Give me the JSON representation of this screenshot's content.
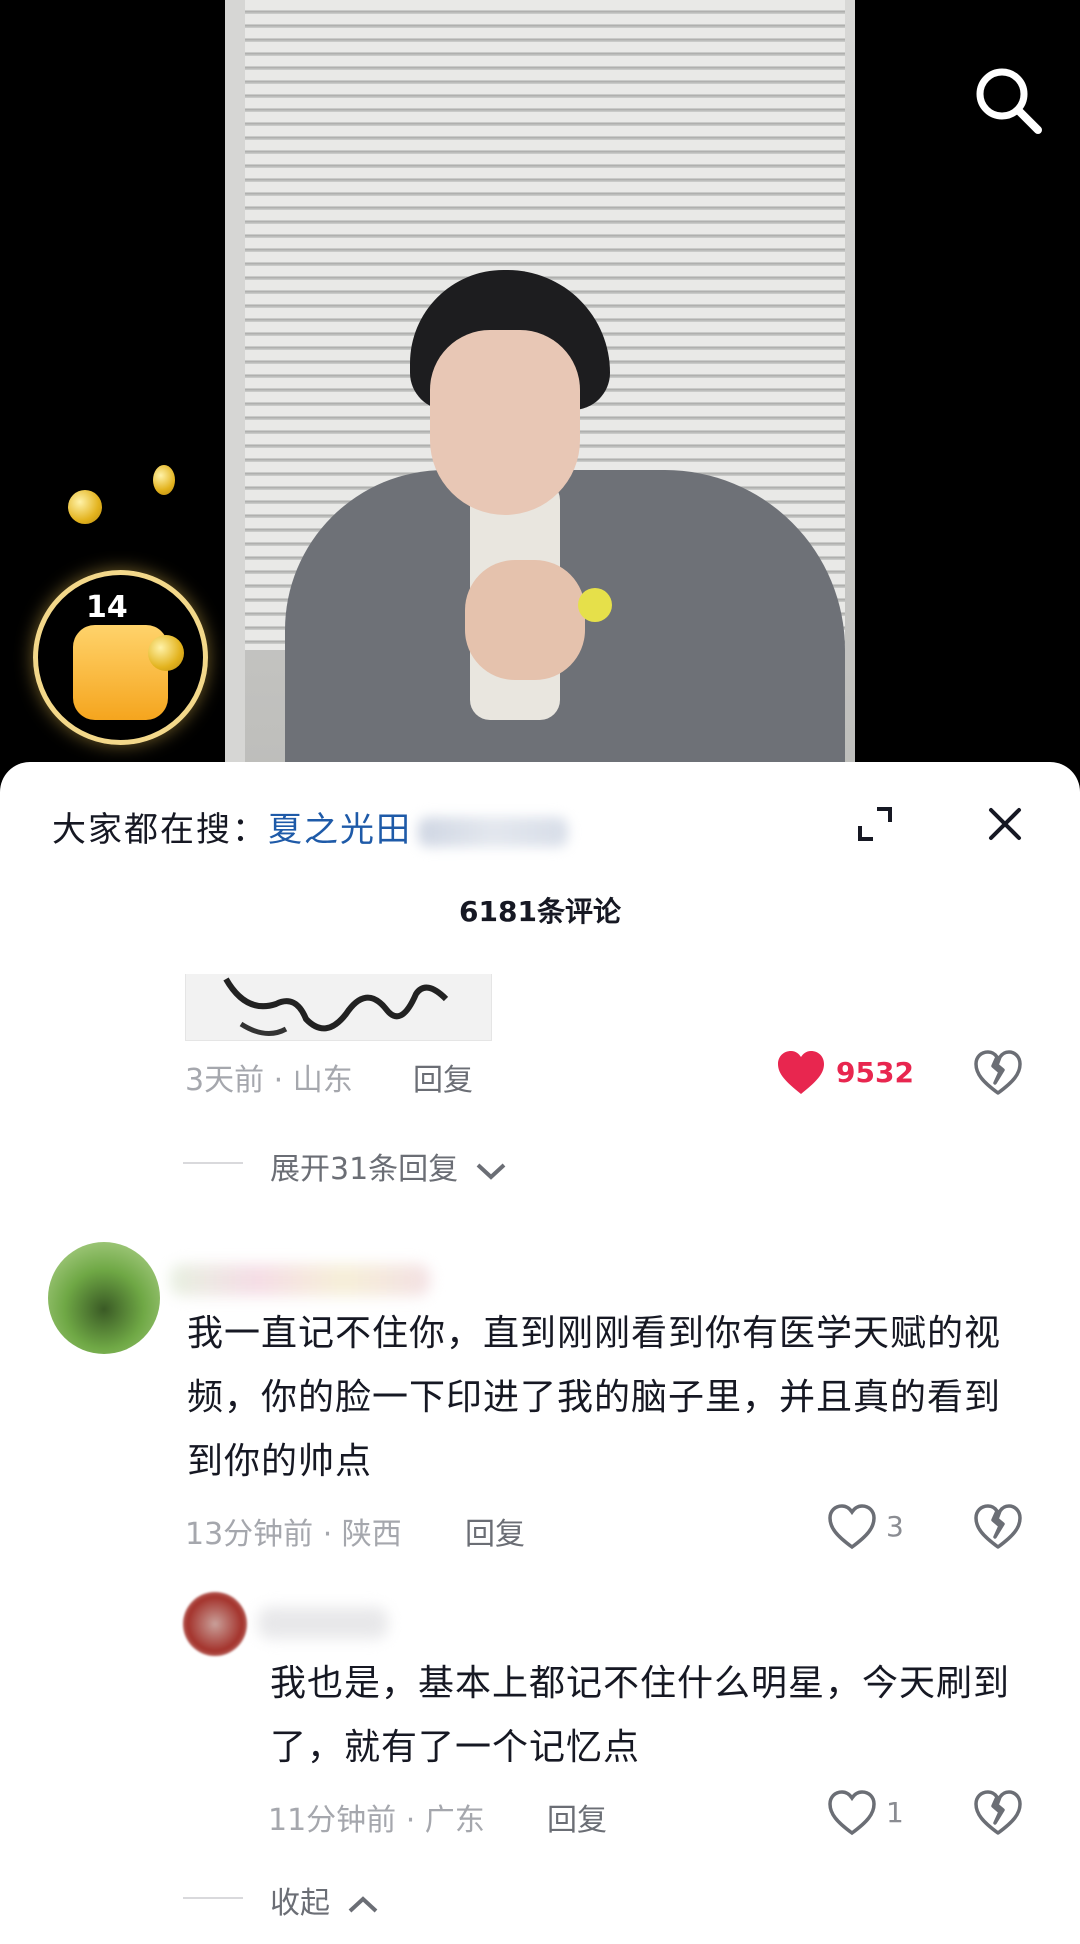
{
  "search_banner": {
    "label": "大家都在搜：",
    "query": "夏之光田"
  },
  "comment_count": "6181条评论",
  "comments": [
    {
      "time_location": "3天前 · 山东",
      "reply_label": "回复",
      "likes": "9532",
      "liked": true,
      "expand_label": "展开31条回复"
    },
    {
      "text": "我一直记不住你，直到刚刚看到你有医学天赋的视频，你的脸一下印进了我的脑子里，并且真的看到到你的帅点",
      "time_location": "13分钟前 · 陕西",
      "reply_label": "回复",
      "likes": "3",
      "replies": [
        {
          "text": "我也是，基本上都记不住什么明星，今天刷到了，就有了一个记忆点",
          "time_location": "11分钟前 · 广东",
          "reply_label": "回复",
          "likes": "1"
        }
      ],
      "collapse_label": "收起"
    }
  ],
  "colors": {
    "link": "#1e5aa8",
    "like_red": "#e8264f",
    "meta_gray": "#a5a7ad"
  },
  "widget": {
    "coin_count": "14"
  }
}
